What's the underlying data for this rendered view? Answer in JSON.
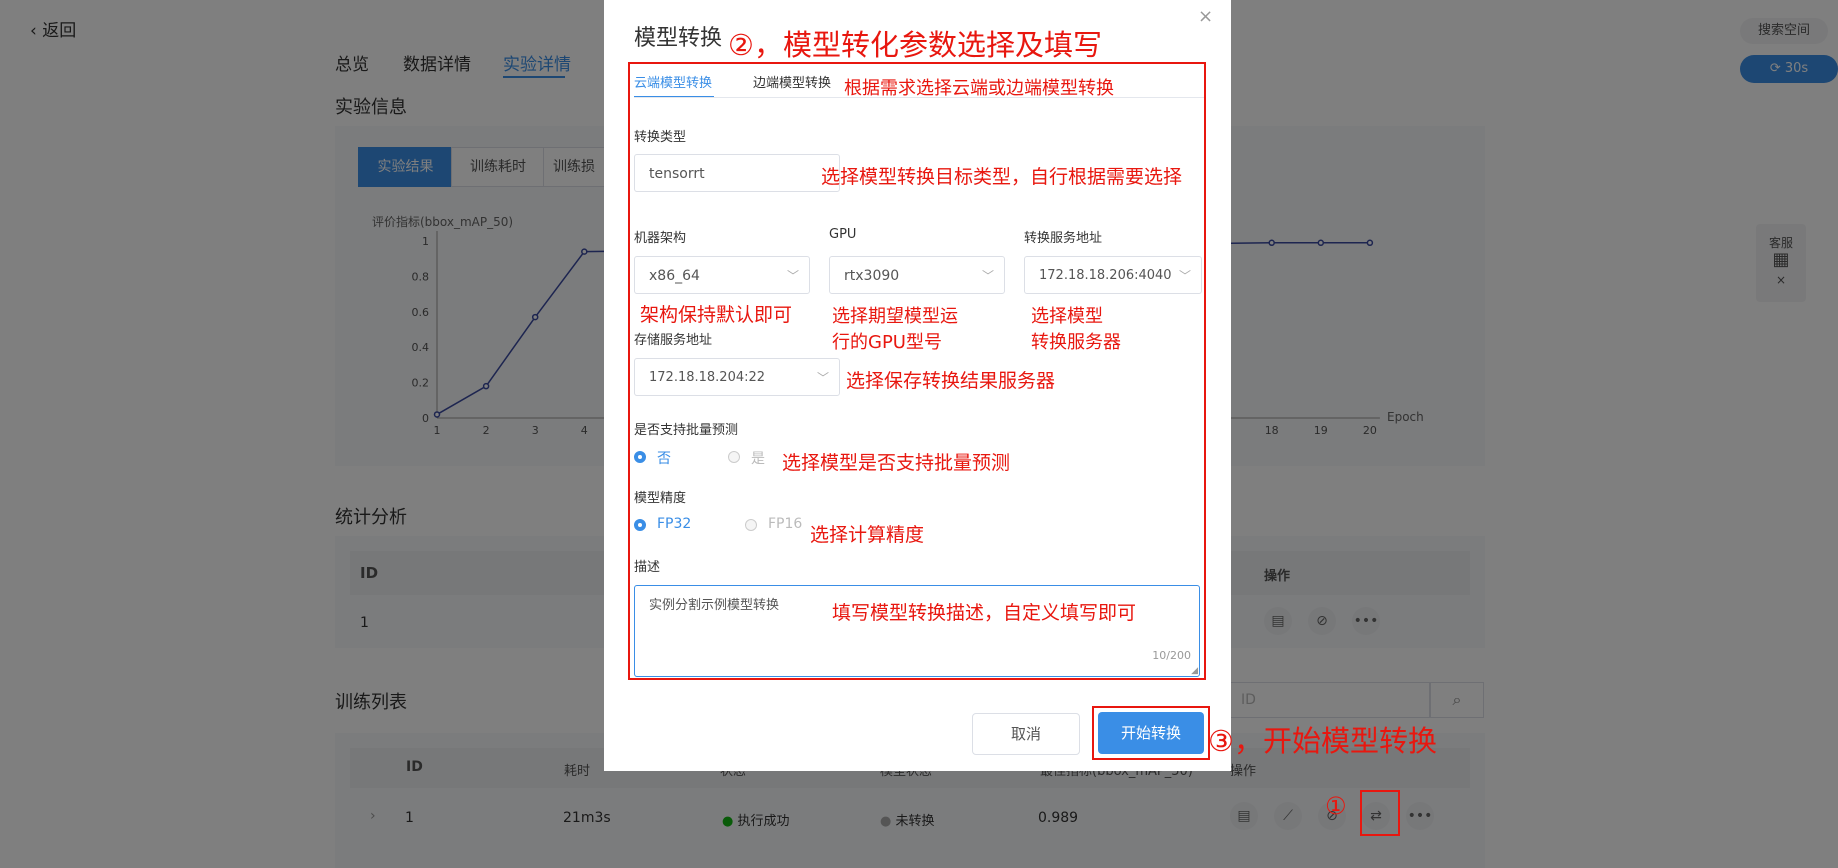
{
  "back": {
    "label": "返回"
  },
  "tabs": [
    {
      "label": "总览"
    },
    {
      "label": "数据详情"
    },
    {
      "label": "实验详情",
      "active": true
    }
  ],
  "experiment_info": {
    "title": "实验信息",
    "segments": [
      "实验结果",
      "训练耗时",
      "训练损"
    ],
    "chart": {
      "ylabel": "评价指标(bbox_mAP_50)",
      "xlabel": "Epoch",
      "y_ticks": [
        "1",
        "0.8",
        "0.6",
        "0.4",
        "0.2",
        "0"
      ],
      "x_ticks_left": [
        "1",
        "2",
        "3",
        "4"
      ],
      "x_ticks_right": [
        "18",
        "19",
        "20"
      ]
    }
  },
  "chart_data": {
    "type": "line",
    "ylabel": "评价指标(bbox_mAP_50)",
    "xlabel": "Epoch",
    "ylim": [
      0,
      1
    ],
    "series": [
      {
        "x": [
          1,
          2,
          3,
          4,
          18,
          19,
          20
        ],
        "values": [
          0.02,
          0.18,
          0.57,
          0.94,
          0.99,
          0.99,
          0.99
        ]
      }
    ]
  },
  "stats": {
    "title": "统计分析",
    "head": {
      "id": "ID",
      "ops": "操作"
    },
    "row": {
      "id": "1"
    }
  },
  "train_list": {
    "title": "训练列表",
    "search_placeholder": "ID",
    "head": {
      "id": "ID",
      "time": "耗时",
      "status": "状态",
      "model_status": "模型状态",
      "metric": "最佳指标(bbox_mAP_50)",
      "ops": "操作"
    },
    "row": {
      "id": "1",
      "time": "21m3s",
      "status": "执行成功",
      "model_status": "未转换",
      "metric": "0.989"
    }
  },
  "right_panel": {
    "search_space": "搜索空间",
    "refresh": "30s",
    "service": "客服"
  },
  "modal": {
    "title": "模型转换",
    "close": "×",
    "tabs": [
      "云端模型转换",
      "边端模型转换"
    ],
    "convert_type": {
      "label": "转换类型",
      "value": "tensorrt"
    },
    "arch": {
      "label": "机器架构",
      "value": "x86_64"
    },
    "gpu": {
      "label": "GPU",
      "value": "rtx3090"
    },
    "convert_server": {
      "label": "转换服务地址",
      "value": "172.18.18.206:4040"
    },
    "storage_server": {
      "label": "存储服务地址",
      "value": "172.18.18.204:22"
    },
    "batch": {
      "label": "是否支持批量预测",
      "options": [
        "否",
        "是"
      ],
      "selected": "否"
    },
    "precision": {
      "label": "模型精度",
      "options": [
        "FP32",
        "FP16"
      ],
      "selected": "FP32"
    },
    "desc": {
      "label": "描述",
      "value": "实例分割示例模型转换",
      "count": "10/200"
    },
    "cancel": "取消",
    "start": "开始转换"
  },
  "annotations": {
    "a2": "②，模型转化参数选择及填写",
    "tab_note": "根据需求选择云端或边端模型转换",
    "type_note": "选择模型转换目标类型，自行根据需要选择",
    "arch_note": "架构保持默认即可",
    "gpu_note_1": "选择期望模型运",
    "gpu_note_2": "行的GPU型号",
    "server_note_1": "选择模型",
    "server_note_2": "转换服务器",
    "storage_note": "选择保存转换结果服务器",
    "batch_note": "选择模型是否支持批量预测",
    "precision_note": "选择计算精度",
    "desc_note": "填写模型转换描述，自定义填写即可",
    "a3": "③，开始模型转换",
    "a1": "①"
  },
  "colors": {
    "accent": "#3a8ee6",
    "annotation": "#e8170f",
    "success": "#12b712"
  }
}
